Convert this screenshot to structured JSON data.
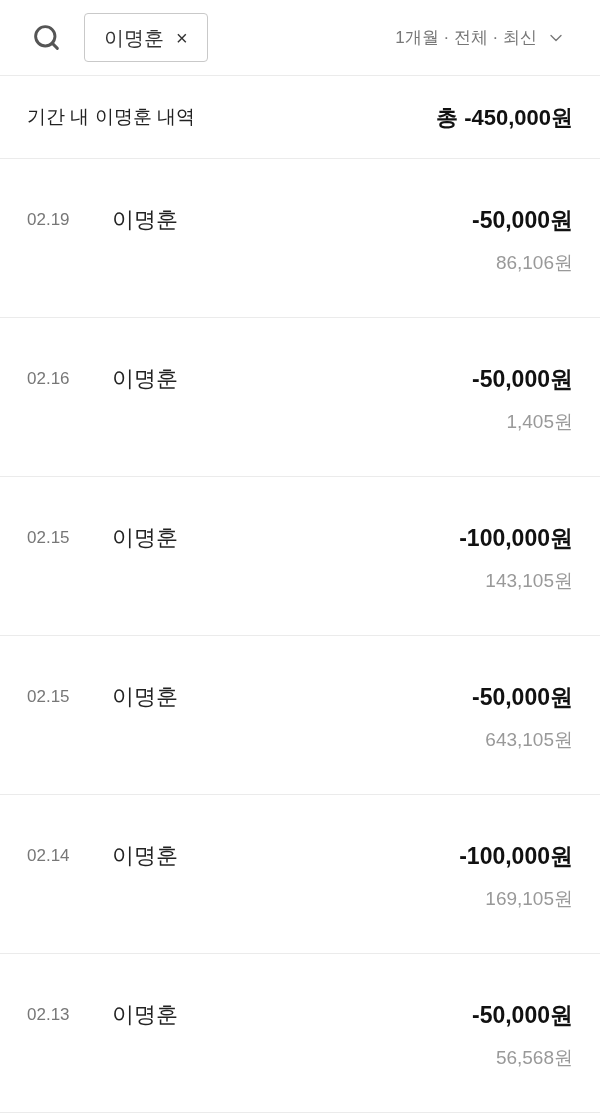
{
  "search": {
    "query": "이명훈",
    "clear": "×"
  },
  "filter": {
    "label": "1개월 · 전체 · 최신"
  },
  "summary": {
    "label": "기간 내 이명훈 내역",
    "total": "총 -450,000원"
  },
  "transactions": [
    {
      "date": "02.19",
      "name": "이명훈",
      "amount": "-50,000원",
      "balance": "86,106원"
    },
    {
      "date": "02.16",
      "name": "이명훈",
      "amount": "-50,000원",
      "balance": "1,405원"
    },
    {
      "date": "02.15",
      "name": "이명훈",
      "amount": "-100,000원",
      "balance": "143,105원"
    },
    {
      "date": "02.15",
      "name": "이명훈",
      "amount": "-50,000원",
      "balance": "643,105원"
    },
    {
      "date": "02.14",
      "name": "이명훈",
      "amount": "-100,000원",
      "balance": "169,105원"
    },
    {
      "date": "02.13",
      "name": "이명훈",
      "amount": "-50,000원",
      "balance": "56,568원"
    }
  ]
}
